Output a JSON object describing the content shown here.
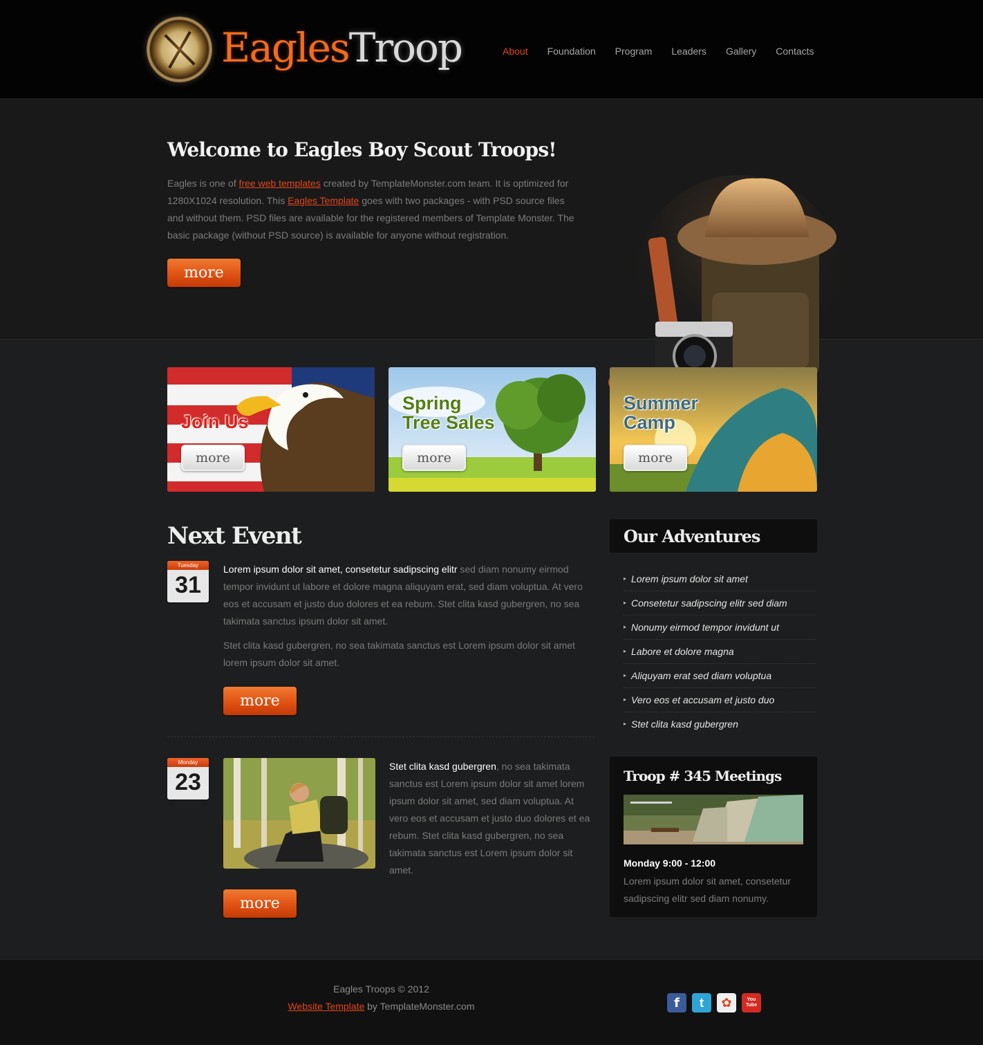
{
  "brand": {
    "part1": "Eagles",
    "part2": "Troop"
  },
  "nav": [
    {
      "label": "About",
      "active": true
    },
    {
      "label": "Foundation"
    },
    {
      "label": "Program"
    },
    {
      "label": "Leaders"
    },
    {
      "label": "Gallery"
    },
    {
      "label": "Contacts"
    }
  ],
  "hero": {
    "title": "Welcome to Eagles Boy Scout Troops!",
    "text_1": "Eagles is one of ",
    "link_1": "free web templates",
    "text_2": " created by TemplateMonster.com team. It is optimized for 1280X1024 resolution. This ",
    "link_2": "Eagles Template",
    "text_3": " goes with two packages - with PSD source files and without them. PSD files are available for the registered members of Template Monster. The basic package (without PSD source) is available for anyone without registration.",
    "button": "more"
  },
  "banners": [
    {
      "title_1": "Join Us",
      "title_2": "",
      "button": "more"
    },
    {
      "title_1": "Spring",
      "title_2": "Tree Sales",
      "button": "more"
    },
    {
      "title_1": "Summer",
      "title_2": "Camp",
      "button": "more"
    }
  ],
  "next_event": {
    "title": "Next Event",
    "events": [
      {
        "weekday": "Tuesday",
        "day": "31",
        "lead": "Lorem ipsum dolor sit amet, consetetur sadipscing elitr",
        "text": " sed diam nonumy eirmod tempor invidunt ut labore et dolore magna aliquyam erat, sed diam voluptua. At vero eos et accusam et justo duo dolores et ea rebum. Stet clita kasd gubergren, no sea takimata sanctus ipsum dolor sit amet.",
        "text_2": "Stet clita kasd gubergren, no sea takimata sanctus est Lorem ipsum dolor sit amet lorem ipsum dolor sit amet.",
        "button": "more"
      },
      {
        "weekday": "Monday",
        "day": "23",
        "lead": "Stet clita kasd gubergren",
        "text": ", no sea takimata sanctus est Lorem ipsum dolor sit amet lorem ipsum dolor sit amet, sed diam voluptua. At vero eos et accusam et justo duo dolores et ea rebum. Stet clita kasd gubergren, no sea takimata sanctus est Lorem ipsum dolor sit amet.",
        "button": "more"
      }
    ]
  },
  "adventures": {
    "title": "Our Adventures",
    "items": [
      "Lorem ipsum dolor sit amet",
      "Consetetur sadipscing elitr sed diam",
      "Nonumy eirmod tempor invidunt ut",
      "Labore et dolore magna",
      "Aliquyam erat sed diam voluptua",
      "Vero eos et accusam et justo duo",
      "Stet clita kasd gubergren"
    ]
  },
  "meetings": {
    "title": "Troop # 345 Meetings",
    "time": "Monday 9:00 - 12:00",
    "text": "Lorem ipsum dolor sit amet, consetetur sadipscing elitr sed diam nonumy."
  },
  "footer": {
    "copyright": "Eagles Troops © 2012",
    "link": "Website Template",
    "by": " by TemplateMonster.com",
    "social": [
      {
        "icon": "facebook-icon",
        "glyph": "f",
        "color": "#3b5b9a"
      },
      {
        "icon": "twitter-icon",
        "glyph": "t",
        "color": "#2fa5d6"
      },
      {
        "icon": "picasa-icon",
        "glyph": "✿",
        "color": "#f0f0f0"
      },
      {
        "icon": "youtube-icon",
        "glyph": "You Tube",
        "color": "#d52a22"
      }
    ]
  },
  "colors": {
    "accent": "#e2461a",
    "background": "#1d1e1f",
    "header": "#030303"
  }
}
